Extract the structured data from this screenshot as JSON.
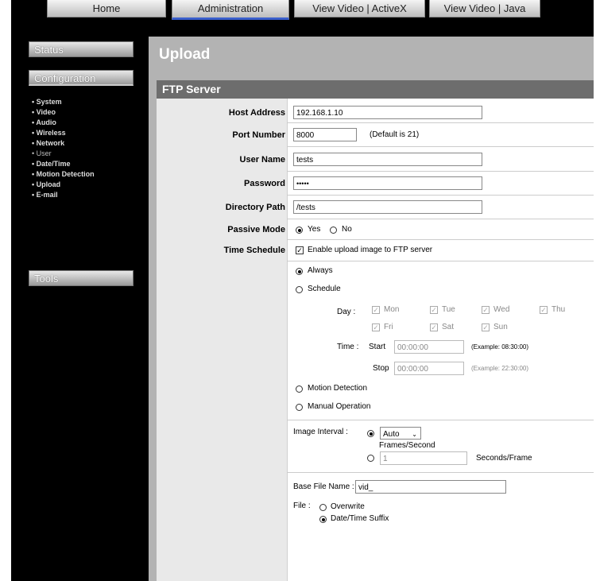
{
  "topnav": {
    "home": "Home",
    "administration": "Administration",
    "view_activex": "View Video | ActiveX",
    "view_java": "View Video | Java"
  },
  "sidebar": {
    "status": "Status",
    "configuration": "Configuration",
    "items": [
      "System",
      "Video",
      "Audio",
      "Wireless",
      "Network",
      "User",
      "Date/Time",
      "Motion Detection",
      "Upload",
      "E-mail"
    ],
    "tools": "Tools"
  },
  "page": {
    "title": "Upload"
  },
  "ftp": {
    "section_title": "FTP Server",
    "host_label": "Host Address",
    "host_value": "192.168.1.10",
    "port_label": "Port Number",
    "port_value": "8000",
    "port_hint": "(Default is 21)",
    "user_label": "User Name",
    "user_value": "tests",
    "password_label": "Password",
    "password_value": "•••••",
    "dir_label": "Directory Path",
    "dir_value": "/tests",
    "passive_label": "Passive Mode",
    "passive_yes": "Yes",
    "passive_no": "No",
    "schedule_label": "Time Schedule",
    "enable_text": "Enable upload image to FTP server",
    "always": "Always",
    "schedule": "Schedule",
    "day_label": "Day :",
    "days": [
      "Mon",
      "Tue",
      "Wed",
      "Thu",
      "Fri",
      "Sat",
      "Sun"
    ],
    "time_label": "Time :",
    "start_label": "Start",
    "start_value": "00:00:00",
    "start_example": "(Example: 08:30:00)",
    "stop_label": "Stop",
    "stop_value": "00:00:00",
    "stop_example": "(Example: 22:30:00)",
    "motion": "Motion Detection",
    "manual": "Manual Operation",
    "interval_label": "Image Interval :",
    "interval_select": "Auto",
    "frames_sec": "Frames/Second",
    "sec_value": "1",
    "sec_frame": "Seconds/Frame",
    "base_label": "Base File Name :",
    "base_value": "vid_",
    "file_label": "File :",
    "overwrite": "Overwrite",
    "datetime_suffix": "Date/Time Suffix"
  }
}
